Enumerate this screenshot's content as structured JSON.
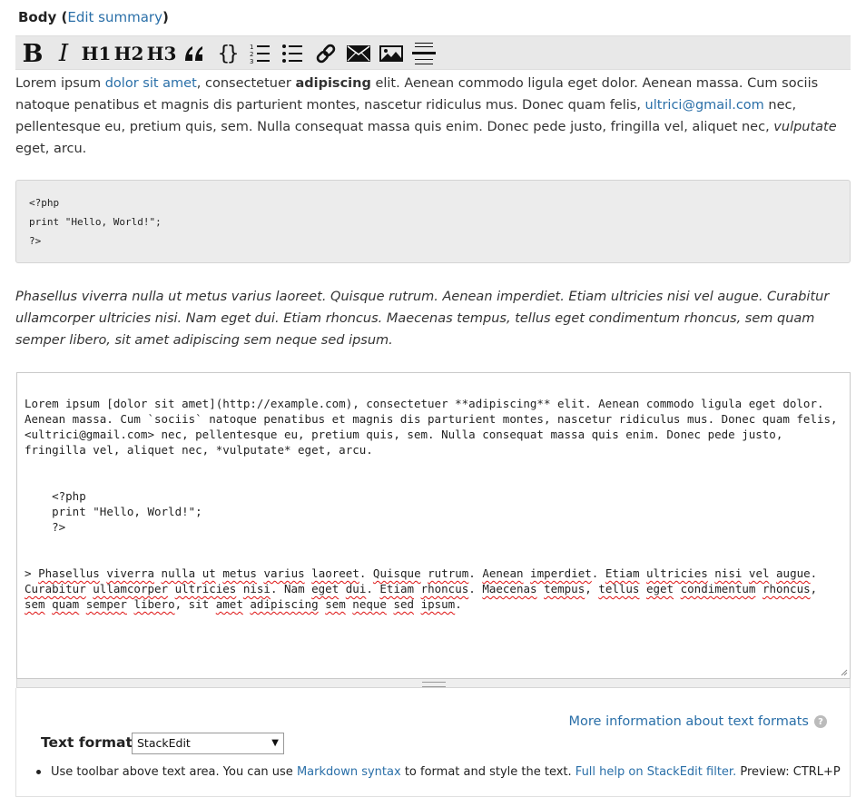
{
  "field": {
    "label": "Body",
    "paren_open": "(",
    "paren_close": ")",
    "edit_summary": "Edit summary"
  },
  "toolbar": {
    "buttons": [
      {
        "name": "bold",
        "icon": "bold-icon"
      },
      {
        "name": "italic",
        "icon": "italic-icon"
      },
      {
        "name": "h1",
        "label": "H1"
      },
      {
        "name": "h2",
        "label": "H2"
      },
      {
        "name": "h3",
        "label": "H3"
      },
      {
        "name": "blockquote",
        "icon": "quote-icon"
      },
      {
        "name": "code",
        "icon": "code-braces-icon"
      },
      {
        "name": "ordered-list",
        "icon": "ordered-list-icon"
      },
      {
        "name": "unordered-list",
        "icon": "bullet-list-icon"
      },
      {
        "name": "link",
        "icon": "link-icon"
      },
      {
        "name": "email",
        "icon": "envelope-icon"
      },
      {
        "name": "image",
        "icon": "image-icon"
      },
      {
        "name": "horizontal-rule",
        "icon": "hr-icon"
      }
    ]
  },
  "preview": {
    "p1_a": "Lorem ipsum ",
    "p1_link": "dolor sit amet",
    "p1_b": ", consectetuer ",
    "p1_bold": "adipiscing",
    "p1_c": " elit. Aenean commodo ligula eget dolor. Aenean massa. Cum sociis natoque penatibus et magnis dis parturient montes, nascetur ridiculus mus. Donec quam felis, ",
    "p1_email": "ultrici@gmail.com",
    "p1_d": " nec, pellentesque eu, pretium quis, sem. Nulla consequat massa quis enim. Donec pede justo, fringilla vel, aliquet nec, ",
    "p1_em": "vulputate",
    "p1_e": " eget, arcu.",
    "code": "<?php\nprint \"Hello, World!\";\n?>",
    "quote": "Phasellus viverra nulla ut metus varius laoreet. Quisque rutrum. Aenean imperdiet. Etiam ultricies nisi vel augue. Curabitur ullamcorper ultricies nisi. Nam eget dui. Etiam rhoncus. Maecenas tempus, tellus eget condimentum rhoncus, sem quam semper libero, sit amet adipiscing sem neque sed ipsum."
  },
  "editor": {
    "para1": "Lorem ipsum [dolor sit amet](http://example.com), consectetuer **adipiscing** elit. Aenean commodo ligula eget dolor. Aenean massa. Cum `sociis` natoque penatibus et magnis dis parturient montes, nascetur ridiculus mus. Donec quam felis, <ultrici@gmail.com> nec, pellentesque eu, pretium quis, sem. Nulla consequat massa quis enim. Donec pede justo, fringilla vel, aliquet nec, *vulputate* eget, arcu.",
    "code": "    <?php\n    print \"Hello, World!\";\n    ?>",
    "quote_words": [
      {
        "t": "> ",
        "s": false
      },
      {
        "t": "Phasellus",
        "s": true
      },
      {
        "t": " ",
        "s": false
      },
      {
        "t": "viverra",
        "s": true
      },
      {
        "t": " ",
        "s": false
      },
      {
        "t": "nulla",
        "s": true
      },
      {
        "t": " ",
        "s": false
      },
      {
        "t": "ut",
        "s": true
      },
      {
        "t": " ",
        "s": false
      },
      {
        "t": "metus",
        "s": true
      },
      {
        "t": " ",
        "s": false
      },
      {
        "t": "varius",
        "s": true
      },
      {
        "t": " ",
        "s": false
      },
      {
        "t": "laoreet",
        "s": true
      },
      {
        "t": ". ",
        "s": false
      },
      {
        "t": "Quisque",
        "s": true
      },
      {
        "t": " ",
        "s": false
      },
      {
        "t": "rutrum",
        "s": true
      },
      {
        "t": ". ",
        "s": false
      },
      {
        "t": "Aenean",
        "s": true
      },
      {
        "t": " ",
        "s": false
      },
      {
        "t": "imperdiet",
        "s": true
      },
      {
        "t": ". ",
        "s": false
      },
      {
        "t": "Etiam",
        "s": true
      },
      {
        "t": " ",
        "s": false
      },
      {
        "t": "ultricies",
        "s": true
      },
      {
        "t": " ",
        "s": false
      },
      {
        "t": "nisi",
        "s": true
      },
      {
        "t": " ",
        "s": false
      },
      {
        "t": "vel",
        "s": true
      },
      {
        "t": " ",
        "s": false
      },
      {
        "t": "augue",
        "s": true
      },
      {
        "t": ". ",
        "s": false
      },
      {
        "t": "Curabitur",
        "s": true
      },
      {
        "t": " ",
        "s": false
      },
      {
        "t": "ullamcorper",
        "s": true
      },
      {
        "t": " ",
        "s": false
      },
      {
        "t": "ultricies",
        "s": true
      },
      {
        "t": " ",
        "s": false
      },
      {
        "t": "nisi",
        "s": true
      },
      {
        "t": ". Nam ",
        "s": false
      },
      {
        "t": "eget",
        "s": true
      },
      {
        "t": " ",
        "s": false
      },
      {
        "t": "dui",
        "s": true
      },
      {
        "t": ". ",
        "s": false
      },
      {
        "t": "Etiam",
        "s": true
      },
      {
        "t": " ",
        "s": false
      },
      {
        "t": "rhoncus",
        "s": true
      },
      {
        "t": ". ",
        "s": false
      },
      {
        "t": "Maecenas",
        "s": true
      },
      {
        "t": " ",
        "s": false
      },
      {
        "t": "tempus",
        "s": true
      },
      {
        "t": ", ",
        "s": false
      },
      {
        "t": "tellus",
        "s": true
      },
      {
        "t": " ",
        "s": false
      },
      {
        "t": "eget",
        "s": true
      },
      {
        "t": " ",
        "s": false
      },
      {
        "t": "condimentum",
        "s": true
      },
      {
        "t": " ",
        "s": false
      },
      {
        "t": "rhoncus",
        "s": true
      },
      {
        "t": ", ",
        "s": false
      },
      {
        "t": "sem",
        "s": true
      },
      {
        "t": " ",
        "s": false
      },
      {
        "t": "quam",
        "s": true
      },
      {
        "t": " ",
        "s": false
      },
      {
        "t": "semper",
        "s": true
      },
      {
        "t": " ",
        "s": false
      },
      {
        "t": "libero",
        "s": true
      },
      {
        "t": ", sit ",
        "s": false
      },
      {
        "t": "amet",
        "s": true
      },
      {
        "t": " ",
        "s": false
      },
      {
        "t": "adipiscing",
        "s": true
      },
      {
        "t": " ",
        "s": false
      },
      {
        "t": "sem",
        "s": true
      },
      {
        "t": " ",
        "s": false
      },
      {
        "t": "neque",
        "s": true
      },
      {
        "t": " ",
        "s": false
      },
      {
        "t": "sed",
        "s": true
      },
      {
        "t": " ",
        "s": false
      },
      {
        "t": "ipsum",
        "s": true
      },
      {
        "t": ".",
        "s": false
      }
    ]
  },
  "filter": {
    "more_info": "More information about text formats",
    "help_glyph": "?",
    "format_label": "Text format",
    "format_selected": "StackEdit",
    "tip_a": "Use toolbar above text area. You can use ",
    "tip_link1": "Markdown syntax",
    "tip_b": " to format and style the text. ",
    "tip_link2": "Full help on StackEdit filter.",
    "tip_c": " Preview: CTRL+P"
  },
  "colors": {
    "link": "#2a6fa8",
    "toolbar_bg": "#e8e8e8",
    "code_bg": "#ececec",
    "spellcheck": "#dd1111"
  }
}
